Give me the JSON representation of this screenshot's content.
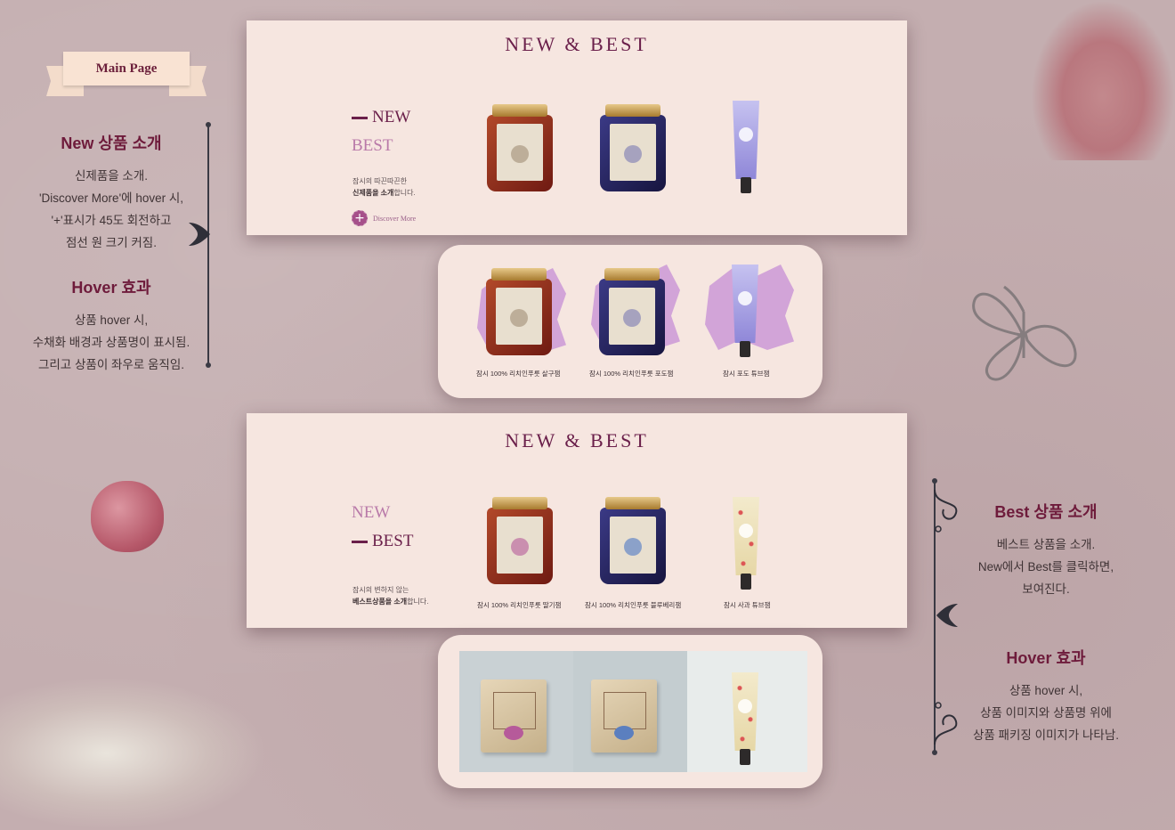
{
  "tag": {
    "label": "Main Page"
  },
  "left_notes": [
    {
      "title": "New 상품 소개",
      "lines": [
        "신제품을 소개.",
        "'Discover More'에 hover 시,",
        "'+'표시가 45도 회전하고",
        "점선 원 크기 커짐."
      ]
    },
    {
      "title": "Hover 효과",
      "lines": [
        "상품 hover 시,",
        "수채화 배경과 상품명이 표시됨.",
        "그리고 상품이 좌우로 움직임."
      ]
    }
  ],
  "right_notes": [
    {
      "title": "Best 상품 소개",
      "lines": [
        "베스트 상품을 소개.",
        "New에서 Best를 클릭하면,",
        "보여진다."
      ]
    },
    {
      "title": "Hover 효과",
      "lines": [
        "상품 hover 시,",
        "상품 이미지와 상품명 위에",
        "상품 패키징 이미지가 나타남."
      ]
    }
  ],
  "panel_new": {
    "title": "NEW & BEST",
    "tab_new": "NEW",
    "tab_best": "BEST",
    "desc_line1": "잠시의 따끈따끈한",
    "desc_line2_bold": "신제품을 소개",
    "desc_line2_rest": "합니다.",
    "discover_label": "Discover More",
    "discover_icon": "+"
  },
  "hover_new": {
    "products": [
      "잠시 100% 리치인푸룻 살구잼",
      "잠시 100% 리치인푸룻 포도잼",
      "잠시 포도 튜브잼"
    ]
  },
  "panel_best": {
    "title": "NEW & BEST",
    "tab_new": "NEW",
    "tab_best": "BEST",
    "desc_line1": "잠시의 변하지 않는",
    "desc_line2_bold": "베스트상품을 소개",
    "desc_line2_rest": "합니다.",
    "products": [
      "잠시 100% 리치인푸룻 딸기잼",
      "잠시 100% 리치인푸룻 블루베리잼",
      "잠시 사과 튜브잼"
    ]
  },
  "colors": {
    "background": "#c4aeb0",
    "panel": "#f6e6e0",
    "accent": "#6a1f4a",
    "inactive_tab": "#b97aa9",
    "note_title": "#6e1b3b"
  }
}
